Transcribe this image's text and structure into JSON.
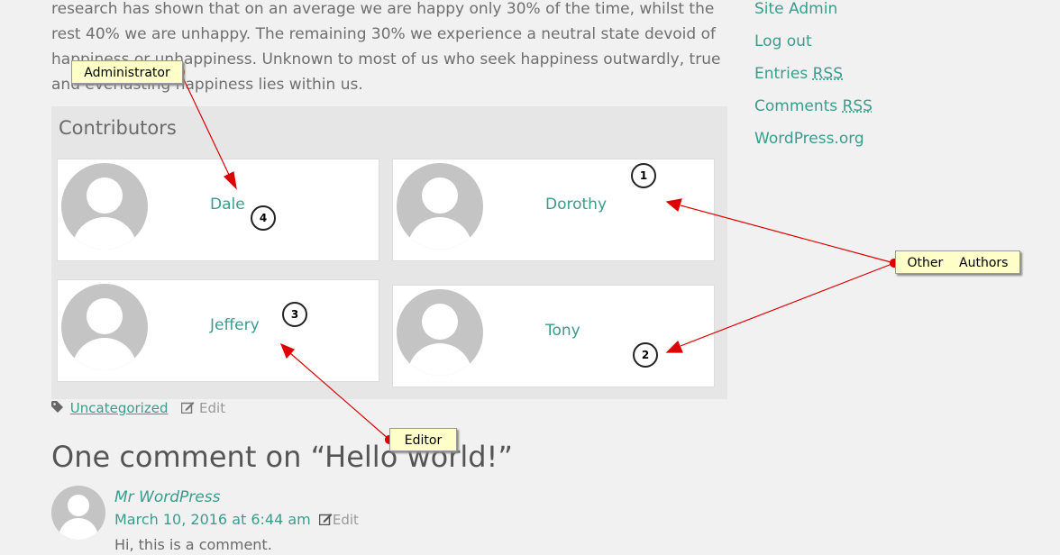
{
  "post": {
    "paragraph": "research has shown that on an average we are happy only 30% of the time, whilst the rest 40% we are unhappy. The remaining 30% we experience a neutral state devoid of happiness or unhappiness. Unknown to most of us who seek happiness outwardly, true and everlasting happiness lies within us."
  },
  "sidebar": {
    "site_admin": "Site Admin",
    "log_out": "Log out",
    "entries": "Entries",
    "comments": "Comments",
    "rss": "RSS",
    "wordpress_org": "WordPress.org"
  },
  "contributors": {
    "title": "Contributors",
    "people": [
      {
        "name": "Dale"
      },
      {
        "name": "Dorothy"
      },
      {
        "name": "Jeffery"
      },
      {
        "name": "Tony"
      }
    ]
  },
  "meta": {
    "category": "Uncategorized",
    "edit": "Edit"
  },
  "comments": {
    "title": "One comment on “Hello world!”",
    "author": "Mr WordPress",
    "date": "March 10, 2016 at 6:44 am",
    "edit": "Edit",
    "text": "Hi, this is a comment."
  },
  "annotations": {
    "administrator": "Administrator",
    "other_authors": "Other    Authors",
    "editor": "Editor",
    "n1": "1",
    "n2": "2",
    "n3": "3",
    "n4": "4"
  },
  "colors": {
    "link": "#3a9d8c",
    "callout_bg": "#fefec8",
    "arrow": "#dd0000"
  },
  "icons": {
    "tag": "tag-icon",
    "edit": "edit-icon"
  }
}
